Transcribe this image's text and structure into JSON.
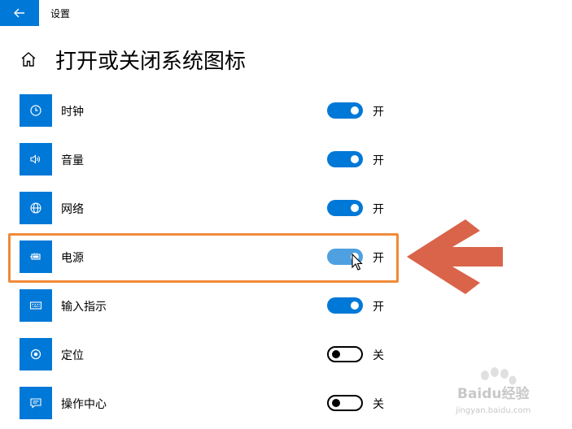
{
  "window": {
    "title": "设置"
  },
  "page": {
    "title": "打开或关闭系统图标"
  },
  "settings": [
    {
      "label": "时钟",
      "icon": "clock-icon",
      "state": "开",
      "on": true
    },
    {
      "label": "音量",
      "icon": "volume-icon",
      "state": "开",
      "on": true
    },
    {
      "label": "网络",
      "icon": "globe-icon",
      "state": "开",
      "on": true
    },
    {
      "label": "电源",
      "icon": "battery-icon",
      "state": "开",
      "on": true
    },
    {
      "label": "输入指示",
      "icon": "keyboard-icon",
      "state": "开",
      "on": true
    },
    {
      "label": "定位",
      "icon": "location-icon",
      "state": "关",
      "on": false
    },
    {
      "label": "操作中心",
      "icon": "action-center-icon",
      "state": "关",
      "on": false
    }
  ],
  "watermark": {
    "brand": "Baidu经验",
    "url": "jingyan.baidu.com"
  },
  "colors": {
    "accent": "#0078d7",
    "highlight": "#f08a38",
    "arrow": "#d9644a"
  }
}
